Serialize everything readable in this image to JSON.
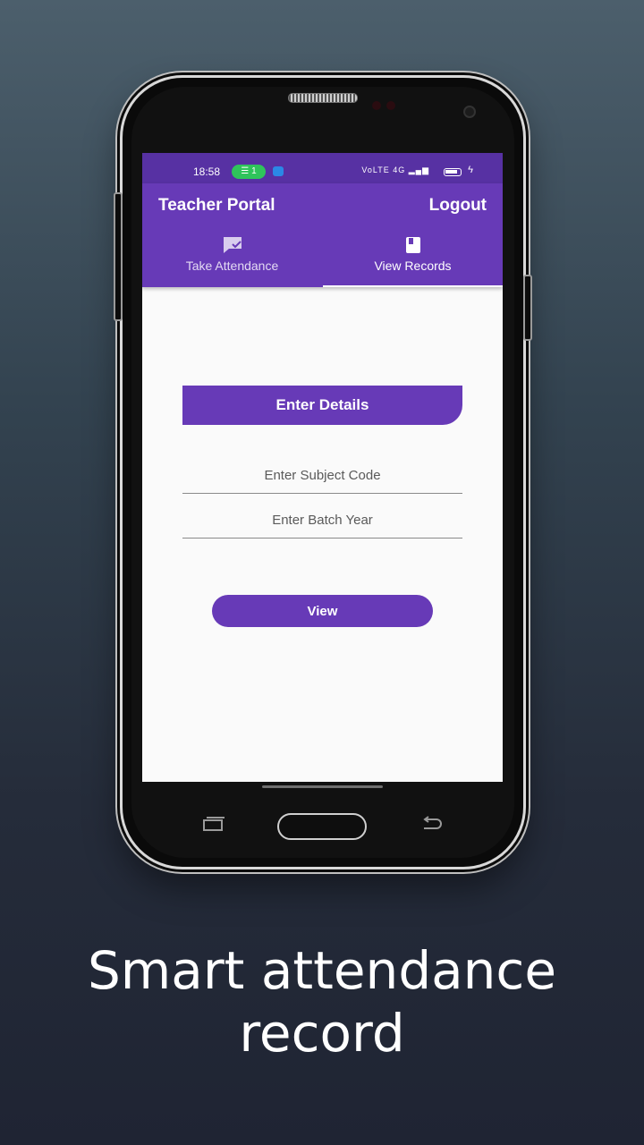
{
  "status_bar": {
    "time": "18:58",
    "hotspot": "1",
    "network": "VoLTE 4G"
  },
  "app_bar": {
    "title": "Teacher Portal",
    "logout_label": "Logout"
  },
  "tabs": [
    {
      "label": "Take Attendance",
      "icon": "attendance-chat-icon"
    },
    {
      "label": "View Records",
      "icon": "book-icon"
    }
  ],
  "form": {
    "banner": "Enter Details",
    "subject_placeholder": "Enter Subject Code",
    "batch_placeholder": "Enter Batch Year",
    "view_label": "View"
  },
  "caption": {
    "line1": "Smart attendance",
    "line2": "record"
  },
  "colors": {
    "primary": "#673ab7",
    "status_bar": "#5731a3",
    "background": "#fafafa"
  }
}
